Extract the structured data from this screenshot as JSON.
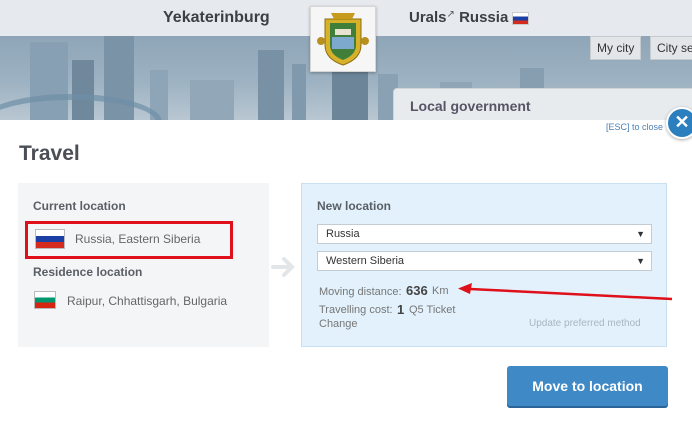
{
  "header": {
    "city": "Yekaterinburg",
    "region": "Urals",
    "country": "Russia",
    "tabs": [
      "My city",
      "City se"
    ],
    "background_panel_title": "Local government"
  },
  "dialog": {
    "esc_hint": "[ESC] to close",
    "close_icon": "close-icon",
    "title": "Travel",
    "current_location_label": "Current location",
    "current_location": "Russia, Eastern Siberia",
    "residence_location_label": "Residence location",
    "residence_location": "Raipur, Chhattisgarh, Bulgaria",
    "new_location_label": "New location",
    "country_select": "Russia",
    "region_select": "Western Siberia",
    "moving_distance_label": "Moving distance:",
    "moving_distance_value": "636",
    "moving_distance_unit": "Km",
    "travelling_cost_label": "Travelling cost:",
    "travelling_cost_value": "1",
    "travelling_cost_unit": "Q5 Ticket",
    "change_label": "Change",
    "update_method_label": "Update preferred method",
    "move_button": "Move to location"
  },
  "colors": {
    "accent": "#3f8ac6",
    "highlight": "#e0101a",
    "new_location_bg": "#e2f1fb"
  }
}
